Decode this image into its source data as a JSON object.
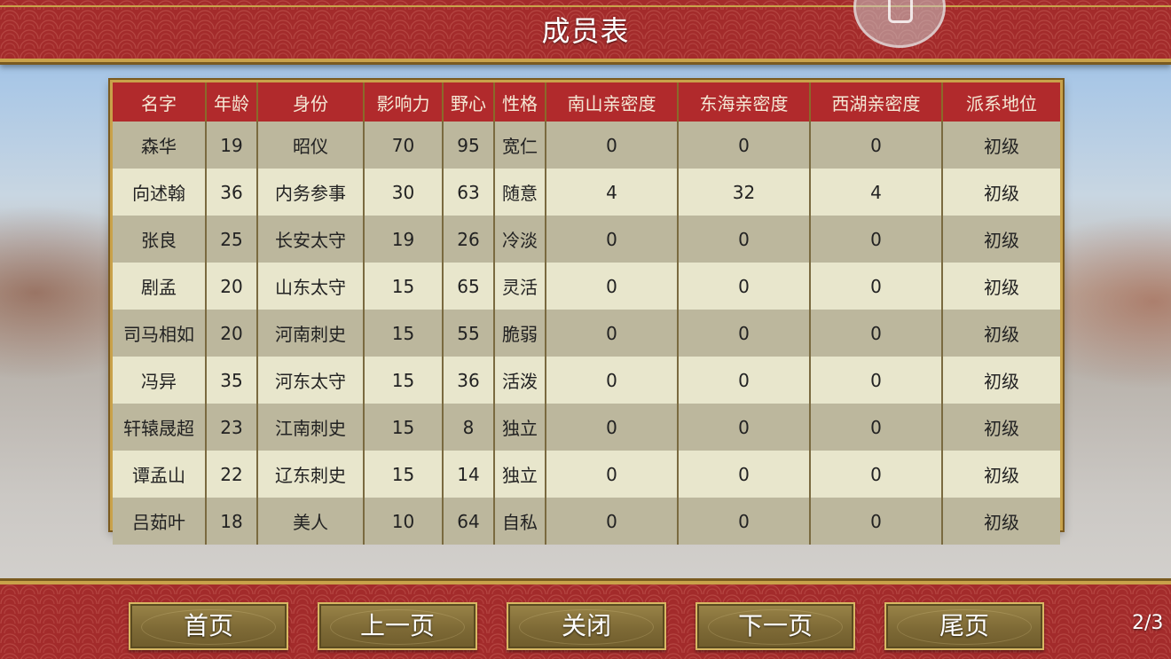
{
  "title": "成员表",
  "table": {
    "headers": [
      "名字",
      "年龄",
      "身份",
      "影响力",
      "野心",
      "性格",
      "南山亲密度",
      "东海亲密度",
      "西湖亲密度",
      "派系地位"
    ],
    "rows": [
      [
        "森华",
        "19",
        "昭仪",
        "70",
        "95",
        "宽仁",
        "0",
        "0",
        "0",
        "初级"
      ],
      [
        "向述翰",
        "36",
        "内务参事",
        "30",
        "63",
        "随意",
        "4",
        "32",
        "4",
        "初级"
      ],
      [
        "张良",
        "25",
        "长安太守",
        "19",
        "26",
        "冷淡",
        "0",
        "0",
        "0",
        "初级"
      ],
      [
        "剧孟",
        "20",
        "山东太守",
        "15",
        "65",
        "灵活",
        "0",
        "0",
        "0",
        "初级"
      ],
      [
        "司马相如",
        "20",
        "河南刺史",
        "15",
        "55",
        "脆弱",
        "0",
        "0",
        "0",
        "初级"
      ],
      [
        "冯异",
        "35",
        "河东太守",
        "15",
        "36",
        "活泼",
        "0",
        "0",
        "0",
        "初级"
      ],
      [
        "轩辕晟超",
        "23",
        "江南刺史",
        "15",
        "8",
        "独立",
        "0",
        "0",
        "0",
        "初级"
      ],
      [
        "谭孟山",
        "22",
        "辽东刺史",
        "15",
        "14",
        "独立",
        "0",
        "0",
        "0",
        "初级"
      ],
      [
        "吕茹叶",
        "18",
        "美人",
        "10",
        "64",
        "自私",
        "0",
        "0",
        "0",
        "初级"
      ]
    ]
  },
  "buttons": {
    "first": "首页",
    "prev": "上一页",
    "close": "关闭",
    "next": "下一页",
    "last": "尾页"
  },
  "page_indicator": "2/3",
  "colors": {
    "banner_red": "#a32b2b",
    "header_red": "#b12a2c",
    "gold": "#c9a24a",
    "row_dark": "#bcb79d",
    "row_light": "#e8e6cc"
  }
}
